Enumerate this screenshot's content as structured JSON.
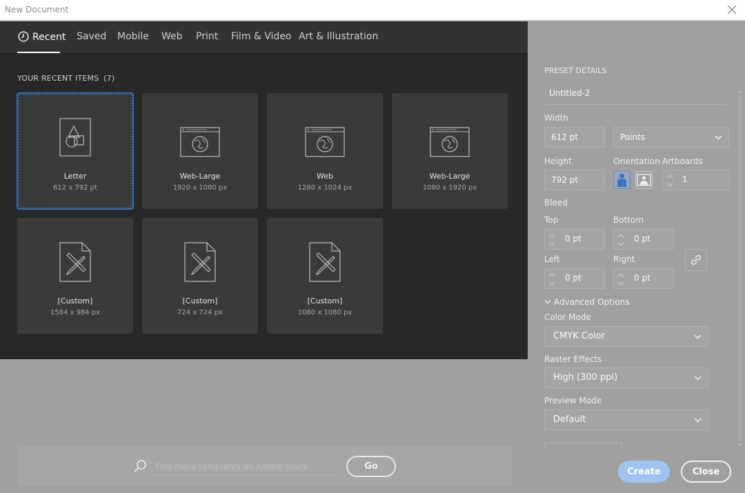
{
  "window": {
    "title": "New Document"
  },
  "tabs": [
    {
      "label": "Recent",
      "active": true
    },
    {
      "label": "Saved"
    },
    {
      "label": "Mobile"
    },
    {
      "label": "Web"
    },
    {
      "label": "Print"
    },
    {
      "label": "Film & Video"
    },
    {
      "label": "Art & Illustration"
    }
  ],
  "recent": {
    "title": "YOUR RECENT ITEMS",
    "count": "(7)",
    "items": [
      {
        "name": "Letter",
        "dim": "612 x 792 pt",
        "icon": "print-document-icon",
        "selected": true
      },
      {
        "name": "Web-Large",
        "dim": "1920 x 1080 px",
        "icon": "web-globe-icon"
      },
      {
        "name": "Web",
        "dim": "1280 x 1024 px",
        "icon": "web-globe-icon"
      },
      {
        "name": "Web-Large",
        "dim": "1080 x 1920 px",
        "icon": "web-globe-icon"
      },
      {
        "name": "[Custom]",
        "dim": "1584 x 984 px",
        "icon": "custom-document-icon"
      },
      {
        "name": "[Custom]",
        "dim": "724 x 724 px",
        "icon": "custom-document-icon"
      },
      {
        "name": "[Custom]",
        "dim": "1080 x 1080 px",
        "icon": "custom-document-icon"
      }
    ]
  },
  "search": {
    "placeholder": "Find more templates on Adobe Stock",
    "go_label": "Go"
  },
  "preset": {
    "title": "PRESET DETAILS",
    "name": "Untitled-2",
    "width_label": "Width",
    "width_value": "612 pt",
    "units": "Points",
    "height_label": "Height",
    "height_value": "792 pt",
    "orientation_label": "Orientation",
    "artboards_label": "Artboards",
    "artboards_value": "1",
    "bleed_label": "Bleed",
    "top_label": "Top",
    "top_value": "0 pt",
    "bottom_label": "Bottom",
    "bottom_value": "0 pt",
    "left_label": "Left",
    "left_value": "0 pt",
    "right_label": "Right",
    "right_value": "0 pt",
    "advanced_label": "Advanced Options",
    "color_mode_label": "Color Mode",
    "color_mode_value": "CMYK Color",
    "raster_label": "Raster Effects",
    "raster_value": "High (300 ppi)",
    "preview_label": "Preview Mode",
    "preview_value": "Default"
  },
  "actions": {
    "create_label": "Create",
    "close_label": "Close"
  },
  "colors": {
    "accent": "#2d7bd6",
    "dark_panel": "#282828",
    "card": "#3a3a3a",
    "overlay": "#a0a0a0",
    "create_button": "#9fc3ef"
  }
}
